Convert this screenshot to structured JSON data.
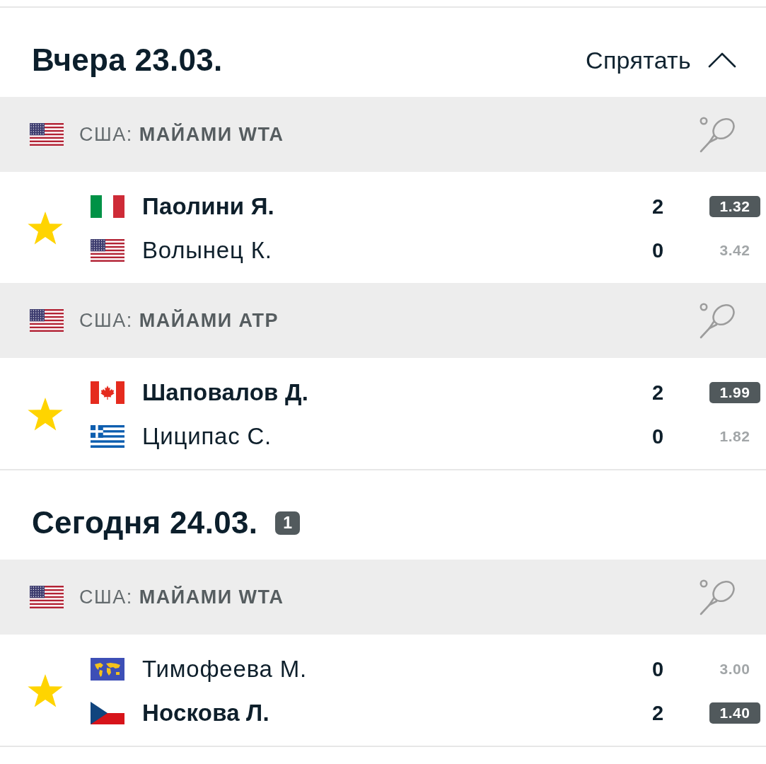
{
  "sections": [
    {
      "title": "Вчера 23.03.",
      "toggle": {
        "label": "Спрятать",
        "expanded": true
      },
      "leagues": [
        {
          "flag": {
            "kind": "us"
          },
          "country": "США:",
          "name": "МАЙАМИ WTA",
          "matches": [
            {
              "favorite": true,
              "players": [
                {
                  "flag": {
                    "kind": "it"
                  },
                  "name": "Паолини Я.",
                  "score": "2",
                  "odds": "1.32",
                  "winner": true
                },
                {
                  "flag": {
                    "kind": "us"
                  },
                  "name": "Волынец К.",
                  "score": "0",
                  "odds": "3.42",
                  "winner": false
                }
              ]
            }
          ]
        },
        {
          "flag": {
            "kind": "us"
          },
          "country": "США:",
          "name": "МАЙАМИ ATP",
          "matches": [
            {
              "favorite": true,
              "players": [
                {
                  "flag": {
                    "kind": "ca"
                  },
                  "name": "Шаповалов Д.",
                  "score": "2",
                  "odds": "1.99",
                  "winner": true
                },
                {
                  "flag": {
                    "kind": "gr"
                  },
                  "name": "Циципас С.",
                  "score": "0",
                  "odds": "1.82",
                  "winner": false
                }
              ]
            }
          ]
        }
      ]
    },
    {
      "title": "Сегодня 24.03.",
      "badge": "1",
      "leagues": [
        {
          "flag": {
            "kind": "us"
          },
          "country": "США:",
          "name": "МАЙАМИ WTA",
          "matches": [
            {
              "favorite": true,
              "players": [
                {
                  "flag": {
                    "kind": "world"
                  },
                  "name": "Тимофеева М.",
                  "score": "0",
                  "odds": "3.00",
                  "winner": false
                },
                {
                  "flag": {
                    "kind": "cz"
                  },
                  "name": "Носкова Л.",
                  "score": "2",
                  "odds": "1.40",
                  "winner": true
                }
              ]
            }
          ]
        }
      ]
    }
  ]
}
